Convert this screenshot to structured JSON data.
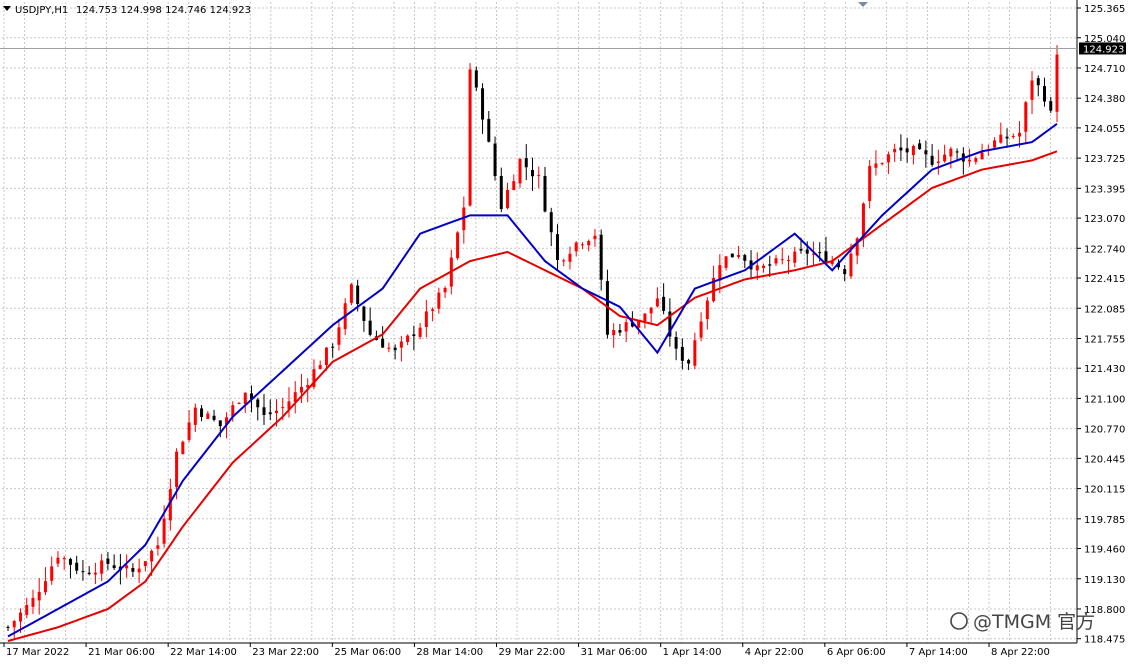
{
  "header": {
    "symbol_timeframe": "USDJPY,H1",
    "ohlc": "124.753 124.998 124.746 124.923"
  },
  "current_price_label": "124.923",
  "watermark": {
    "text": "@TMGM 官方"
  },
  "colors": {
    "bull": "#ff0000",
    "bear": "#000000",
    "ma_fast": "#0000c8",
    "ma_slow": "#e60000",
    "grid": "#c8c8c8",
    "axis": "#000000",
    "price_tag_bg": "#000000"
  },
  "chart_data": {
    "type": "candlestick",
    "title": "USDJPY,H1",
    "y_range": [
      118.45,
      125.365
    ],
    "y_ticks": [
      "125.365",
      "125.040",
      "124.710",
      "124.380",
      "124.055",
      "123.725",
      "123.395",
      "123.070",
      "122.740",
      "122.415",
      "122.085",
      "121.755",
      "121.430",
      "121.100",
      "120.770",
      "120.445",
      "120.115",
      "119.785",
      "119.460",
      "119.130",
      "118.800",
      "118.475"
    ],
    "x_labels": [
      "17 Mar 2022",
      "21 Mar 06:00",
      "22 Mar 14:00",
      "23 Mar 22:00",
      "25 Mar 06:00",
      "28 Mar 14:00",
      "29 Mar 22:00",
      "31 Mar 06:00",
      "1 Apr 14:00",
      "4 Apr 22:00",
      "6 Apr 06:00",
      "7 Apr 14:00",
      "8 Apr 22:00"
    ],
    "close_path": [
      [
        0,
        118.6
      ],
      [
        4,
        118.9
      ],
      [
        8,
        119.4
      ],
      [
        12,
        119.2
      ],
      [
        16,
        119.3
      ],
      [
        20,
        119.2
      ],
      [
        24,
        119.5
      ],
      [
        27,
        120.5
      ],
      [
        30,
        121.0
      ],
      [
        34,
        120.8
      ],
      [
        38,
        121.2
      ],
      [
        41,
        120.9
      ],
      [
        44,
        121.0
      ],
      [
        48,
        121.3
      ],
      [
        52,
        121.7
      ],
      [
        55,
        122.3
      ],
      [
        58,
        121.8
      ],
      [
        62,
        121.6
      ],
      [
        66,
        121.9
      ],
      [
        70,
        122.3
      ],
      [
        73,
        123.2
      ],
      [
        74,
        124.7
      ],
      [
        76,
        124.2
      ],
      [
        79,
        123.2
      ],
      [
        82,
        123.7
      ],
      [
        85,
        123.5
      ],
      [
        88,
        122.6
      ],
      [
        91,
        122.8
      ],
      [
        94,
        122.9
      ],
      [
        96,
        121.8
      ],
      [
        99,
        121.9
      ],
      [
        102,
        122.0
      ],
      [
        104,
        122.2
      ],
      [
        107,
        121.6
      ],
      [
        109,
        121.5
      ],
      [
        111,
        122.0
      ],
      [
        114,
        122.6
      ],
      [
        117,
        122.7
      ],
      [
        120,
        122.5
      ],
      [
        124,
        122.6
      ],
      [
        128,
        122.7
      ],
      [
        132,
        122.6
      ],
      [
        134,
        122.5
      ],
      [
        136,
        122.9
      ],
      [
        138,
        123.6
      ],
      [
        142,
        123.8
      ],
      [
        145,
        123.8
      ],
      [
        148,
        123.7
      ],
      [
        151,
        123.8
      ],
      [
        154,
        123.7
      ],
      [
        158,
        123.9
      ],
      [
        162,
        124.0
      ],
      [
        164,
        124.6
      ],
      [
        166,
        124.4
      ],
      [
        167,
        124.2
      ],
      [
        168,
        124.9
      ]
    ],
    "ma_fast_path": [
      [
        0,
        118.5
      ],
      [
        8,
        118.8
      ],
      [
        16,
        119.1
      ],
      [
        22,
        119.5
      ],
      [
        28,
        120.2
      ],
      [
        36,
        120.9
      ],
      [
        44,
        121.4
      ],
      [
        52,
        121.9
      ],
      [
        60,
        122.3
      ],
      [
        66,
        122.9
      ],
      [
        74,
        123.1
      ],
      [
        80,
        123.1
      ],
      [
        86,
        122.6
      ],
      [
        92,
        122.3
      ],
      [
        98,
        122.1
      ],
      [
        104,
        121.6
      ],
      [
        110,
        122.3
      ],
      [
        118,
        122.5
      ],
      [
        126,
        122.9
      ],
      [
        132,
        122.5
      ],
      [
        140,
        123.1
      ],
      [
        148,
        123.6
      ],
      [
        156,
        123.8
      ],
      [
        164,
        123.9
      ],
      [
        168,
        124.1
      ]
    ],
    "ma_slow_path": [
      [
        0,
        118.45
      ],
      [
        8,
        118.6
      ],
      [
        16,
        118.8
      ],
      [
        22,
        119.1
      ],
      [
        28,
        119.7
      ],
      [
        36,
        120.4
      ],
      [
        44,
        120.9
      ],
      [
        52,
        121.5
      ],
      [
        60,
        121.8
      ],
      [
        66,
        122.3
      ],
      [
        74,
        122.6
      ],
      [
        80,
        122.7
      ],
      [
        86,
        122.5
      ],
      [
        92,
        122.3
      ],
      [
        98,
        122.0
      ],
      [
        104,
        121.9
      ],
      [
        110,
        122.2
      ],
      [
        118,
        122.4
      ],
      [
        126,
        122.5
      ],
      [
        132,
        122.6
      ],
      [
        140,
        123.0
      ],
      [
        148,
        123.4
      ],
      [
        156,
        123.6
      ],
      [
        164,
        123.7
      ],
      [
        168,
        123.8
      ]
    ],
    "candle_count": 169,
    "bar_seed": 7,
    "current_price": 124.923,
    "grid": true
  }
}
